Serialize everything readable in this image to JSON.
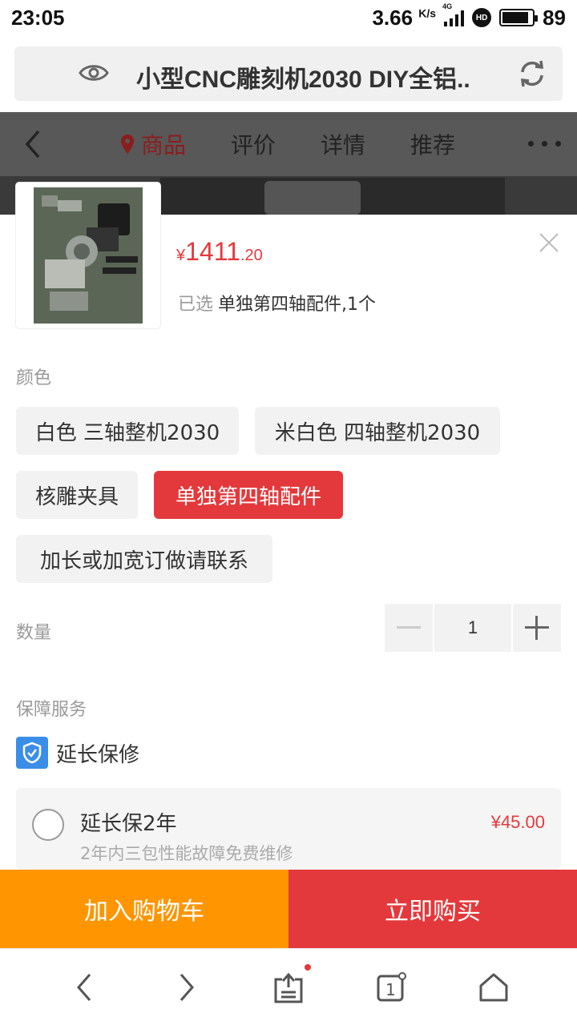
{
  "status": {
    "time": "23:05",
    "speed": "3.66",
    "speed_unit": "K/s",
    "network": "4G",
    "hd": "HD",
    "battery": "89"
  },
  "browser": {
    "title": "小型CNC雕刻机2030 DIY全铝.."
  },
  "nav": {
    "tabs": [
      "商品",
      "评价",
      "详情",
      "推荐"
    ]
  },
  "product": {
    "price_currency": "¥",
    "price_int": "1411",
    "price_dec": ".20",
    "selected_label": "已选",
    "selected_value": "单独第四轴配件,1个"
  },
  "color_section": {
    "label": "颜色",
    "options": [
      "白色 三轴整机2030",
      "米白色 四轴整机2030",
      "核雕夹具",
      "单独第四轴配件",
      "加长或加宽订做请联系"
    ],
    "selected_index": 3
  },
  "quantity": {
    "label": "数量",
    "value": "1"
  },
  "service": {
    "label": "保障服务",
    "warranty_label": "延长保修",
    "plan_name": "延长保2年",
    "plan_desc": "2年内三包性能故障免费维修",
    "plan_price": "¥45.00"
  },
  "actions": {
    "add_to_cart": "加入购物车",
    "buy_now": "立即购买"
  },
  "colors": {
    "accent_red": "#e4393c",
    "cart_orange": "#ff9500",
    "shield_blue": "#3b8ee8"
  }
}
